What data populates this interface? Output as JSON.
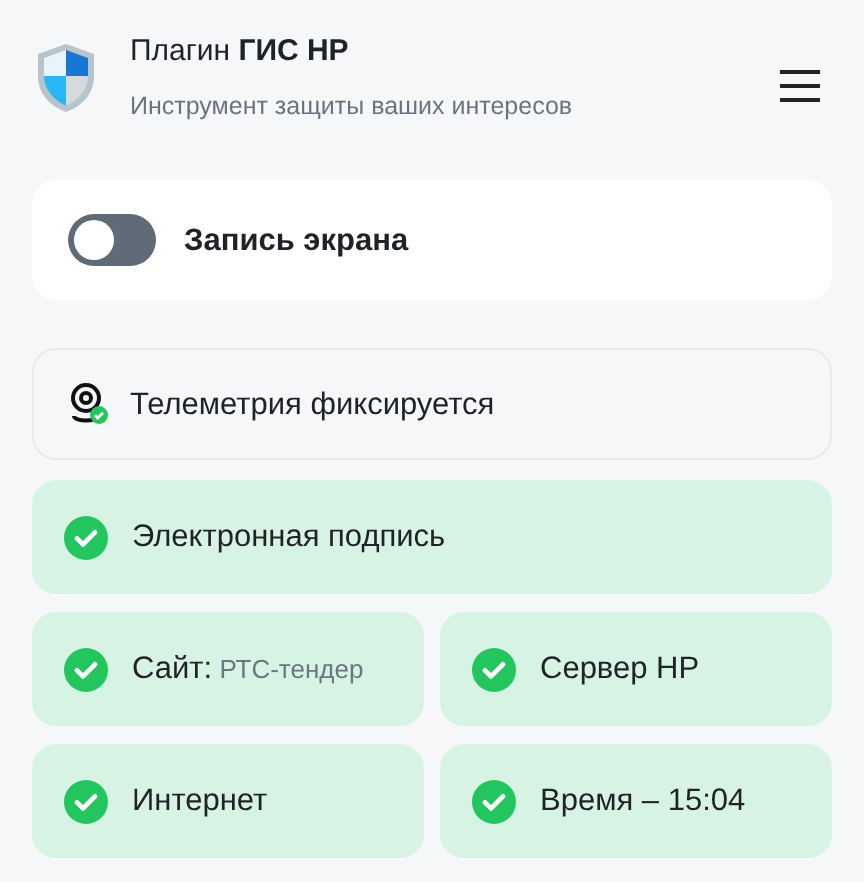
{
  "header": {
    "title": "Плагин **ГИС НР**",
    "subtitle": "Инструмент защиты ваших интересов"
  },
  "screen_recording": {
    "label": "Запись экрана",
    "on": false
  },
  "telemetry": {
    "label": "Телеметрия фиксируется",
    "ok": true
  },
  "signature": {
    "label": "Электронная подпись",
    "ok": true
  },
  "checks": [
    {
      "label": "Сайт:",
      "value": "РТС-тендер",
      "ok": true
    },
    {
      "label": "Сервер НР",
      "ok": true
    },
    {
      "label": "Интернет",
      "ok": true
    },
    {
      "label": "Время – 15:04",
      "ok": true
    }
  ]
}
